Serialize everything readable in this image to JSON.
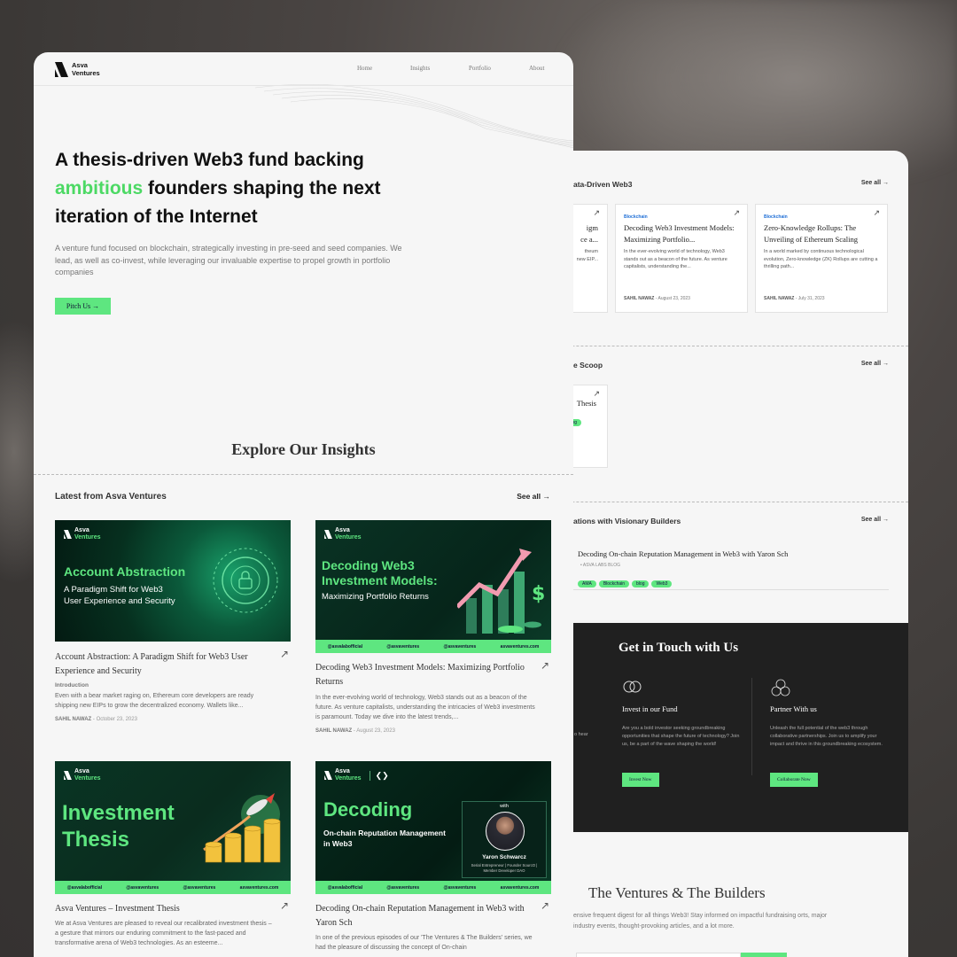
{
  "back_window": {
    "sec1_head": "ata-Driven Web3",
    "sec1_see": "See all →",
    "cards": [
      {
        "tag": "",
        "title": "...igm\n...ce a...",
        "desc": "...theum\n...new EIP...",
        "author": "",
        "date": ""
      },
      {
        "tag": "Blockchain",
        "title": "Decoding Web3 Investment Models: Maximizing Portfolio...",
        "desc": "In the ever-evolving world of technology, Web3 stands out as a beacon of the future. As venture capitalists, understanding the...",
        "author": "SAHIL NAWAZ",
        "date": " - August 23, 2023"
      },
      {
        "tag": "Blockchain",
        "title": "Zero-Knowledge Rollups: The Unveiling of Ethereum Scaling",
        "desc": "In a world marked by continuous technological evolution, Zero-knowledge (ZK) Rollups are cutting a thrilling path...",
        "author": "SAHIL NAWAZ",
        "date": " - July 31, 2023"
      }
    ],
    "sec2_head": "e Scoop",
    "sec2_see": "See all →",
    "sec2_card_title": "Thesis",
    "sec2_card_tag": "log",
    "sec3_head": "ations with Visionary Builders",
    "sec3_see": "See all →",
    "sec3_item_title": "Decoding On-chain Reputation Management in Web3 with Yaron Sch",
    "sec3_item_source": "• ASVA LABS BLOG",
    "sec3_tags": [
      "AMA",
      "Blockchain",
      "blog",
      "Web3"
    ],
    "contact": {
      "title": "Get in Touch with Us",
      "left_fragment": "o hear",
      "invest_title": "Invest in our Fund",
      "invest_desc": "Are you a bold investor seeking groundbreaking opportunities that shape the future of technology? Join us, be a part of the wave shaping the world!",
      "invest_btn": "Invest Now",
      "partner_title": "Partner With us",
      "partner_desc": "Unleash the full potential of the web3 through collaborative partnerships. Join us to amplify your impact and thrive in this groundbreaking ecosystem.",
      "partner_btn": "Collaborate Now"
    },
    "newsletter": {
      "title": "The Ventures & The Builders",
      "desc": "ensive frequent digest for all things Web3! Stay informed on impactful fundraising orts, major industry events, thought-provoking articles, and a lot more."
    }
  },
  "nav": {
    "brand_line1": "Asva",
    "brand_line2": "Ventures",
    "links": [
      "Home",
      "Insights",
      "Portfolio",
      "About"
    ]
  },
  "hero": {
    "title_part1": "A thesis-driven Web3 fund backing ",
    "title_highlight": "ambitious",
    "title_part2": " founders shaping the next iteration of the Internet",
    "subtitle": "A venture fund focused on blockchain, strategically investing in pre-seed and seed companies. We lead, as well as co-invest, while leveraging our invaluable expertise to propel growth in portfolio companies",
    "cta": "Pitch Us →"
  },
  "insights": {
    "heading": "Explore Our Insights",
    "latest_label": "Latest from Asva Ventures",
    "see_all": "See all →"
  },
  "cards": [
    {
      "img_head": "Account Abstraction",
      "img_sub": "A Paradigm Shift for Web3\nUser Experience and Security",
      "title": "Account Abstraction: A Paradigm Shift for Web3 User Experience and Security",
      "intro": "Introduction",
      "desc": "Even with a bear market raging on, Ethereum core developers are ready shipping new EIPs to grow the decentralized economy. Wallets like...",
      "author": "SAHIL NAWAZ",
      "date": " - October 23, 2023"
    },
    {
      "img_head": "Decoding Web3\nInvestment Models:",
      "img_sub": "Maximizing Portfolio Returns",
      "title": "Decoding Web3 Investment Models: Maximizing Portfolio Returns",
      "desc": "In the ever-evolving world of technology, Web3 stands out as a beacon of the future. As venture capitalists, understanding the intricacies of Web3 investments is paramount. Today we dive into the latest trends,...",
      "author": "SAHIL NAWAZ",
      "date": " - August 23, 2023"
    },
    {
      "img_head": "Investment\nThesis",
      "title": "Asva Ventures – Investment Thesis",
      "desc": "We at Asva Ventures are pleased to reveal our recalibrated investment thesis – a gesture that mirrors our enduring commitment to the fast-paced and transformative arena of Web3 technologies. As an esteeme..."
    },
    {
      "img_head": "Decoding",
      "img_sub": "On-chain Reputation Management\nin Web3",
      "with_label": "with",
      "guest_name": "Yaron Schwarcz",
      "guest_role": "Serial Entrepreneur | Founder SourcO | Member Developer DAO",
      "title": "Decoding On-chain Reputation Management in Web3 with Yaron Sch",
      "desc": "In one of the previous episodes of our 'The Ventures & The Builders' series, we had the pleasure of discussing the concept of On-chain"
    }
  ],
  "social": [
    "@asvalabofficial",
    "@asvaventures",
    "@asvaventures",
    "asvaventures.com"
  ],
  "colors": {
    "accent": "#5ee680",
    "highlight": "#4cd964",
    "dark_panel": "#202020"
  }
}
